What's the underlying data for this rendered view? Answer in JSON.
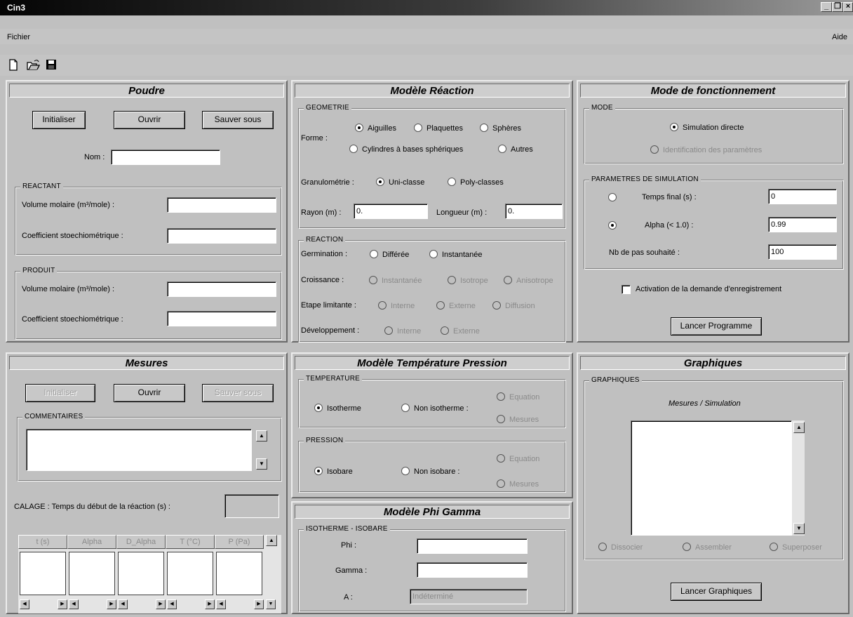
{
  "window": {
    "title": "Cin3",
    "min": "_",
    "max": "❐",
    "close": "×"
  },
  "menu": {
    "file": "Fichier",
    "help": "Aide"
  },
  "toolbar": {
    "new_icon": "new-file-icon",
    "open_icon": "open-folder-icon",
    "save_icon": "save-disk-icon"
  },
  "poudre": {
    "title": "Poudre",
    "init": "Initialiser",
    "open": "Ouvrir",
    "save_as": "Sauver sous",
    "name_label": "Nom :",
    "name_value": "",
    "reactant": {
      "legend": "REACTANT",
      "molar_label": "Volume molaire (m³/mole) :",
      "molar_value": "",
      "stoich_label": "Coefficient stoechiométrique :",
      "stoich_value": ""
    },
    "produit": {
      "legend": "PRODUIT",
      "molar_label": "Volume molaire (m³/mole) :",
      "molar_value": "",
      "stoich_label": "Coefficient stoechiométrique :",
      "stoich_value": ""
    }
  },
  "reaction": {
    "title": "Modèle Réaction",
    "geometrie": {
      "legend": "GEOMETRIE",
      "forme_label": "Forme :",
      "aiguilles": "Aiguilles",
      "plaquettes": "Plaquettes",
      "spheres": "Sphères",
      "cylindres": "Cylindres à bases sphériques",
      "autres": "Autres",
      "granulo_label": "Granulométrie :",
      "uni": "Uni-classe",
      "poly": "Poly-classes",
      "rayon_label": "Rayon (m) :",
      "rayon_value": "0.",
      "longueur_label": "Longueur (m) :",
      "longueur_value": "0."
    },
    "reac": {
      "legend": "REACTION",
      "germ_label": "Germination :",
      "differee": "Différée",
      "instantanee": "Instantanée",
      "crois_label": "Croissance :",
      "c_inst": "Instantanée",
      "c_iso": "Isotrope",
      "c_aniso": "Anisotrope",
      "etape_label": "Etape limitante :",
      "e_int": "Interne",
      "e_ext": "Externe",
      "e_diff": "Diffusion",
      "dev_label": "Développement :",
      "d_int": "Interne",
      "d_ext": "Externe"
    }
  },
  "mode": {
    "title": "Mode de fonctionnement",
    "legend": "MODE",
    "direct": "Simulation directe",
    "ident": "Identification des paramètres",
    "params": {
      "legend": "PARAMETRES DE SIMULATION",
      "temps_label": "Temps final (s) :",
      "temps_value": "0",
      "alpha_label": "Alpha (< 1.0) :",
      "alpha_value": "0.99",
      "pas_label": "Nb de pas souhaité :",
      "pas_value": "100"
    },
    "activation": "Activation de la demande d'enregistrement",
    "launch": "Lancer Programme"
  },
  "mesures": {
    "title": "Mesures",
    "init": "Initialiser",
    "open": "Ouvrir",
    "save_as": "Sauver sous",
    "comments_legend": "COMMENTAIRES",
    "calage_label": "CALAGE : Temps du début de la réaction (s) :",
    "calage_value": "",
    "columns": [
      "t (s)",
      "Alpha",
      "D_Alpha",
      "T (°C)",
      "P (Pa)"
    ]
  },
  "temperature": {
    "title": "Modèle Température Pression",
    "temp_legend": "TEMPERATURE",
    "isotherme": "Isotherme",
    "non_isotherme": "Non isotherme :",
    "t_equation": "Equation",
    "t_mesures": "Mesures",
    "press_legend": "PRESSION",
    "isobare": "Isobare",
    "non_isobare": "Non isobare :",
    "p_equation": "Equation",
    "p_mesures": "Mesures"
  },
  "phigamma": {
    "title": "Modèle Phi Gamma",
    "legend": "ISOTHERME - ISOBARE",
    "phi_label": "Phi :",
    "phi_value": "",
    "gamma_label": "Gamma :",
    "gamma_value": "",
    "a_label": "A :",
    "a_value": "Indéterminé"
  },
  "graphiques": {
    "title": "Graphiques",
    "legend": "GRAPHIQUES",
    "caption": "Mesures / Simulation",
    "dissocier": "Dissocier",
    "assembler": "Assembler",
    "superposer": "Superposer",
    "launch": "Lancer Graphiques"
  }
}
